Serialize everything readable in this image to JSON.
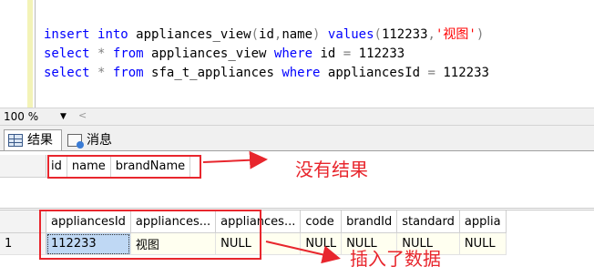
{
  "editor": {
    "lines": [
      [
        {
          "t": "insert",
          "c": "kw"
        },
        {
          "t": " "
        },
        {
          "t": "into",
          "c": "kw"
        },
        {
          "t": " appliances_view"
        },
        {
          "t": "(",
          "c": "op"
        },
        {
          "t": "id"
        },
        {
          "t": ",",
          "c": "op"
        },
        {
          "t": "name"
        },
        {
          "t": ")",
          "c": "op"
        },
        {
          "t": " "
        },
        {
          "t": "values",
          "c": "kw"
        },
        {
          "t": "(",
          "c": "op"
        },
        {
          "t": "112233"
        },
        {
          "t": ",",
          "c": "op"
        },
        {
          "t": "'视图'",
          "c": "str"
        },
        {
          "t": ")",
          "c": "op"
        }
      ],
      [
        {
          "t": "select",
          "c": "kw"
        },
        {
          "t": " "
        },
        {
          "t": "*",
          "c": "op"
        },
        {
          "t": " "
        },
        {
          "t": "from",
          "c": "kw"
        },
        {
          "t": " appliances_view "
        },
        {
          "t": "where",
          "c": "kw"
        },
        {
          "t": " id "
        },
        {
          "t": "=",
          "c": "op"
        },
        {
          "t": " 112233"
        }
      ],
      [
        {
          "t": "select",
          "c": "kw"
        },
        {
          "t": " "
        },
        {
          "t": "*",
          "c": "op"
        },
        {
          "t": " "
        },
        {
          "t": "from",
          "c": "kw"
        },
        {
          "t": " sfa_t_appliances "
        },
        {
          "t": "where",
          "c": "kw"
        },
        {
          "t": " appliancesId "
        },
        {
          "t": "=",
          "c": "op"
        },
        {
          "t": " 112233"
        }
      ]
    ]
  },
  "zoom": {
    "value": "100 %"
  },
  "tabs": {
    "results": "结果",
    "messages": "消息"
  },
  "grid1": {
    "columns": [
      "id",
      "name",
      "brandName"
    ]
  },
  "grid2": {
    "columns": [
      "appliancesId",
      "appliances...",
      "appliances...",
      "code",
      "brandId",
      "standard",
      "applia"
    ],
    "rows": [
      {
        "num": "1",
        "cells": [
          "112233",
          "视图",
          "NULL",
          "NULL",
          "NULL",
          "NULL",
          "NULL"
        ]
      }
    ]
  },
  "annotations": {
    "no_result": "没有结果",
    "inserted": "插入了数据",
    "color": "#e8262d"
  }
}
